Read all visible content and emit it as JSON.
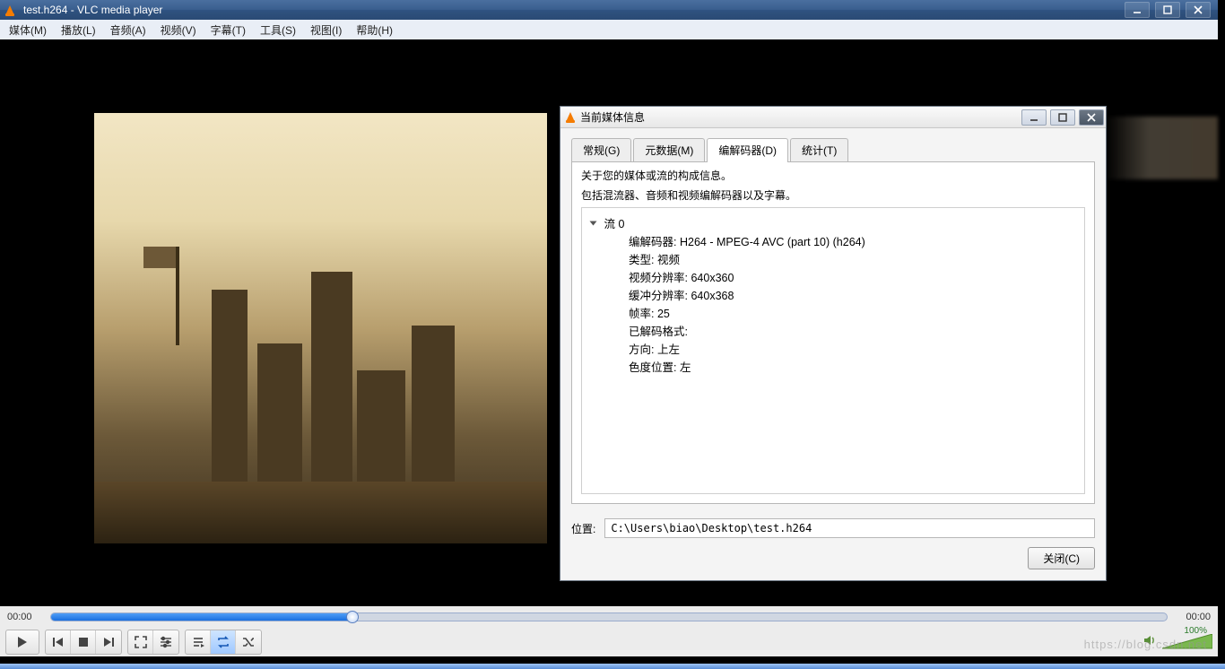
{
  "window": {
    "title": "test.h264 - VLC media player",
    "menu": [
      "媒体(M)",
      "播放(L)",
      "音频(A)",
      "视频(V)",
      "字幕(T)",
      "工具(S)",
      "视图(I)",
      "帮助(H)"
    ]
  },
  "playback": {
    "time_elapsed": "00:00",
    "time_total": "00:00",
    "volume_pct": "100%"
  },
  "dialog": {
    "title": "当前媒体信息",
    "tabs": {
      "general": "常规(G)",
      "metadata": "元数据(M)",
      "codec": "编解码器(D)",
      "stats": "统计(T)"
    },
    "desc_line1": "关于您的媒体或流的构成信息。",
    "desc_line2": "包括混流器、音频和视频编解码器以及字幕。",
    "stream_header": "流 0",
    "fields": {
      "codec": {
        "label": "编解码器:",
        "value": "H264 - MPEG-4 AVC (part 10) (h264)"
      },
      "type": {
        "label": "类型:",
        "value": "视频"
      },
      "video_res": {
        "label": "视频分辨率:",
        "value": "640x360"
      },
      "buffer_res": {
        "label": "缓冲分辨率:",
        "value": "640x368"
      },
      "fps": {
        "label": "帧率:",
        "value": "25"
      },
      "decoded": {
        "label": "已解码格式:",
        "value": ""
      },
      "orient": {
        "label": "方向:",
        "value": "上左"
      },
      "chroma": {
        "label": "色度位置:",
        "value": "左"
      }
    },
    "location_label": "位置:",
    "location_value": "C:\\Users\\biao\\Desktop\\test.h264",
    "close_button": "关闭(C)"
  },
  "watermark": "https://blog.csdn.net"
}
